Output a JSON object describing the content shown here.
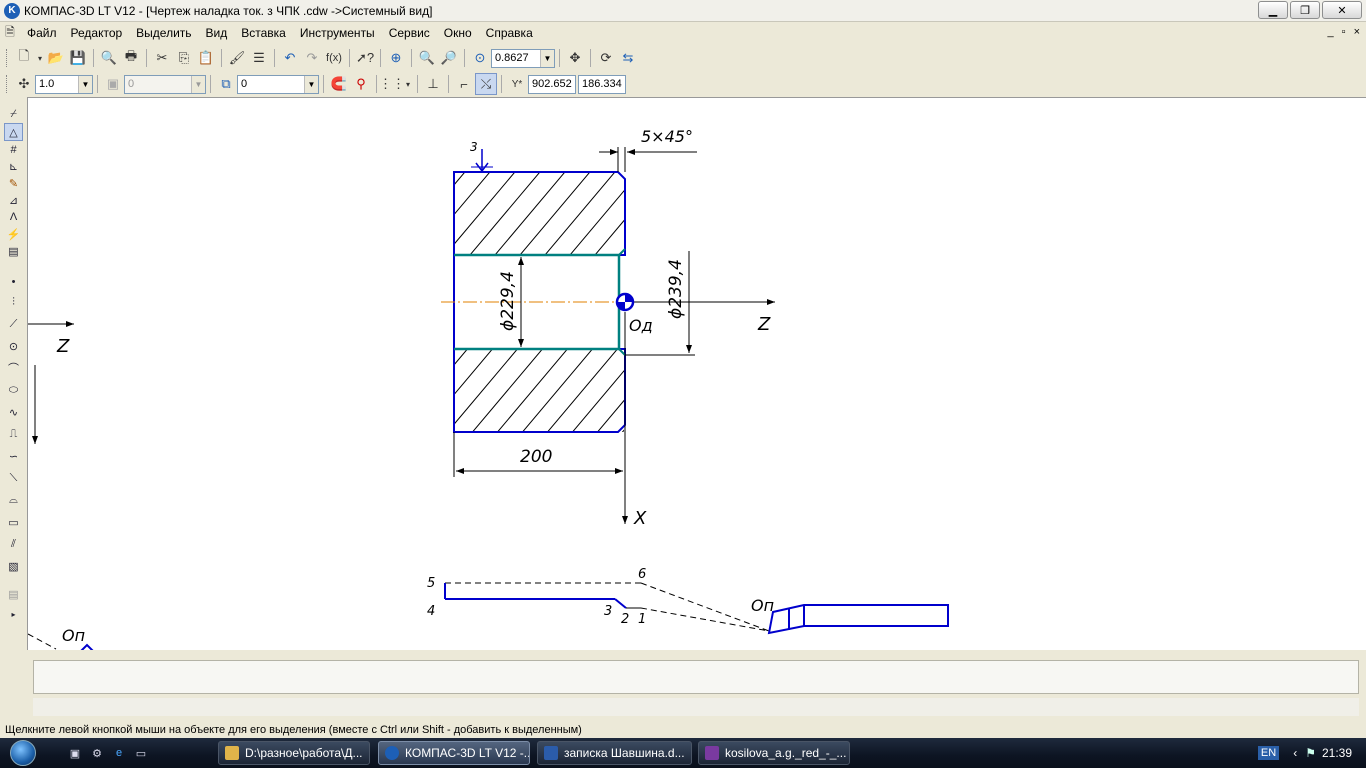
{
  "window": {
    "title": "КОМПАС-3D LT V12 - [Чертеж наладка ток. з ЧПК .cdw ->Системный вид]",
    "logo": "K",
    "controls": [
      "minimize",
      "restore",
      "close"
    ]
  },
  "menu": {
    "items": [
      "Файл",
      "Редактор",
      "Выделить",
      "Вид",
      "Вставка",
      "Инструменты",
      "Сервис",
      "Окно",
      "Справка"
    ],
    "doc_controls": [
      "_",
      "▫",
      "×"
    ]
  },
  "toolbar_top": {
    "zoom_value": "0.8627",
    "fx_label": "f(x)"
  },
  "toolbar_second": {
    "line_scale": "1.0",
    "disabled_combo": "0",
    "layer": "0",
    "x_coord": "902.652",
    "y_coord": "186.334"
  },
  "drawing": {
    "dim_chamfer": "5×45°",
    "dim_diameter_inner": "ϕ229,4",
    "dim_diameter_outer": "ϕ239,4",
    "dim_length": "200",
    "label_point3": "3",
    "label_origin_part": "Од",
    "label_axis_z_right": "Z",
    "label_axis_x": "X",
    "label_axis_z_left": "Z",
    "label_origin_tool": "Оп",
    "label_origin_tool_bottom": "Оп",
    "path_points": [
      "5",
      "6",
      "4",
      "3",
      "2",
      "1"
    ]
  },
  "status": {
    "hint": "Щелкните левой кнопкой мыши на объекте для его выделения (вместе с Ctrl или Shift - добавить к выделенным)"
  },
  "taskbar": {
    "tasks": [
      {
        "label": "D:\\разное\\работа\\Д...",
        "color": "#e0b44a"
      },
      {
        "label": "КОМПАС-3D LT V12 -...",
        "color": "#1d5fb6"
      },
      {
        "label": "записка Шавшина.d...",
        "color": "#2b5caa"
      },
      {
        "label": "kosilova_a.g._red_-_...",
        "color": "#7a3aa0"
      }
    ],
    "lang": "EN",
    "time": "21:39"
  },
  "colors": {
    "drawing_blue": "#0000cc",
    "surface_teal": "#008080",
    "axis_orange": "#e08000"
  }
}
